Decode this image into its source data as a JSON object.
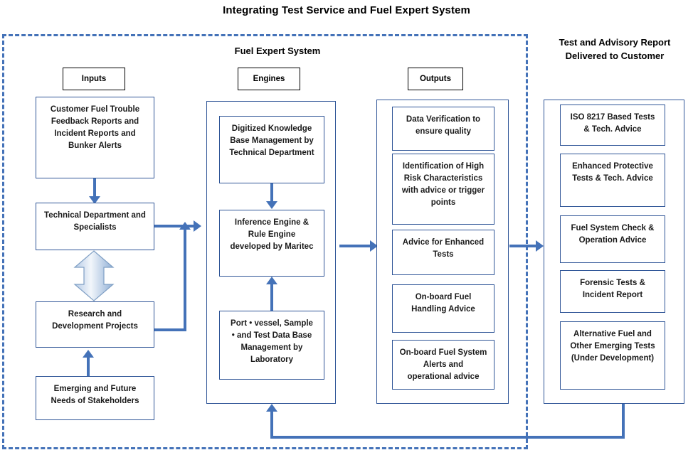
{
  "title": "Integrating Test Service and Fuel Expert System",
  "sections": {
    "fuel_expert_system": "Fuel Expert System",
    "report_line1": "Test and Advisory Report",
    "report_line2": "Delivered to Customer"
  },
  "chips": {
    "inputs": "Inputs",
    "engines": "Engines",
    "outputs": "Outputs"
  },
  "inputs_column": [
    {
      "lines": [
        "Customer Fuel Trouble",
        "Feedback Reports and",
        "Incident Reports and",
        "Bunker Alerts"
      ]
    },
    {
      "lines": [
        "Technical  Department and",
        "Specialists"
      ]
    },
    {
      "lines": [
        "Research and",
        "Development Projects"
      ]
    },
    {
      "lines": [
        "Emerging and Future",
        "Needs of Stakeholders"
      ]
    }
  ],
  "engines_column": [
    {
      "lines": [
        "Digitized Knowledge",
        "Base Management by",
        "Technical  Department"
      ]
    },
    {
      "lines": [
        "Inference Engine &",
        "Rule Engine",
        "developed by Maritec"
      ]
    },
    {
      "lines": [
        "Port •  vessel, Sample",
        "•  and Test Data Base",
        "Management by",
        "Laboratory"
      ]
    }
  ],
  "outputs_column": [
    {
      "lines": [
        "Data Verification to",
        "ensure quality"
      ]
    },
    {
      "lines": [
        "Identification of High",
        "Risk Characteristics",
        "with advice  or trigger",
        "points"
      ]
    },
    {
      "lines": [
        "Advice for Enhanced",
        "Tests"
      ]
    },
    {
      "lines": [
        "On-board Fuel",
        "Handling Advice"
      ]
    },
    {
      "lines": [
        "On-board Fuel System",
        "Alerts and",
        "operational advice"
      ]
    }
  ],
  "report_column": [
    {
      "lines": [
        "ISO 8217 Based Tests",
        "& Tech. Advice"
      ]
    },
    {
      "lines": [
        "Enhanced Protective",
        "Tests & Tech. Advice"
      ]
    },
    {
      "lines": [
        "Fuel System Check &",
        "Operation Advice"
      ]
    },
    {
      "lines": [
        "Forensic Tests &",
        "Incident Report"
      ]
    },
    {
      "lines": [
        "Alternative Fuel and",
        "Other Emerging Tests",
        "(Under Development)"
      ]
    }
  ],
  "colors": {
    "arrow_blue": "#4472b8",
    "box_border_blue": "#2f5597",
    "boundary_dash": "#4472b8",
    "text": "#1a1a1a",
    "gradient_arrow_light": "#eef3fa",
    "gradient_arrow_dark": "#9db9dc"
  }
}
